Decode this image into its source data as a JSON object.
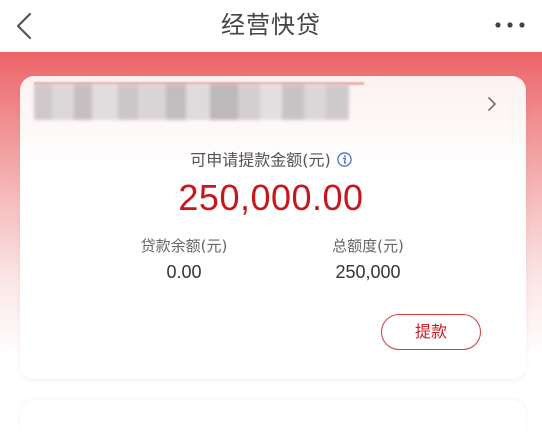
{
  "header": {
    "title": "经营快贷",
    "back_icon": "chevron-left-icon",
    "more_icon": "more-horizontal-icon"
  },
  "loan_card": {
    "account_name_redacted": true,
    "chevron_icon": "chevron-right-icon",
    "available_label": "可申请提款金额(元)",
    "info_icon": "info-icon",
    "available_amount": "250,000.00",
    "balance_label": "贷款余额(元)",
    "balance_value": "0.00",
    "total_label": "总额度(元)",
    "total_value": "250,000",
    "withdraw_button": "提款"
  },
  "colors": {
    "banner_top": "#ec6367",
    "amount_red": "#c8161d",
    "button_border": "#d63a40",
    "info_blue": "#3f66c8"
  }
}
